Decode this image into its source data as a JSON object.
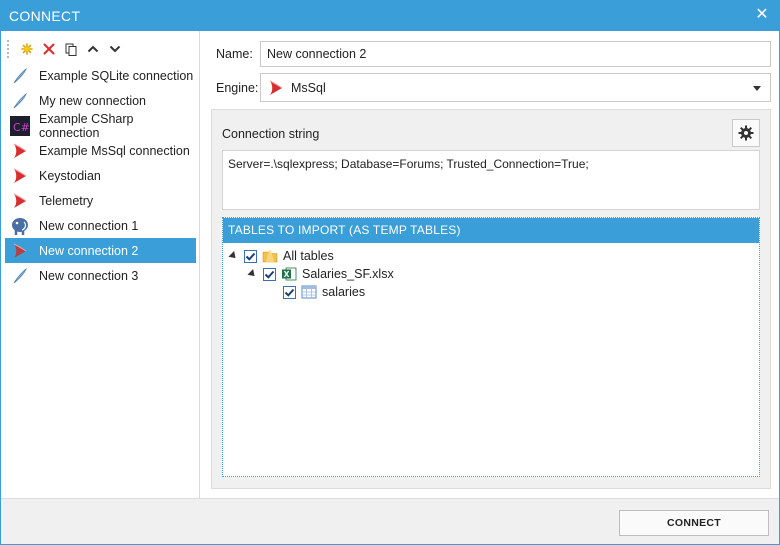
{
  "window": {
    "title": "CONNECT",
    "close_glyph": "✕"
  },
  "toolbar": {
    "buttons": [
      {
        "name": "new-connection-button",
        "icon": "sparkle-icon"
      },
      {
        "name": "delete-connection-button",
        "icon": "red-x-icon"
      },
      {
        "name": "copy-connection-button",
        "icon": "copy-icon"
      },
      {
        "name": "move-up-button",
        "icon": "chevron-up-icon"
      },
      {
        "name": "move-down-button",
        "icon": "chevron-down-icon"
      }
    ]
  },
  "connections": [
    {
      "label": "Example SQLite connection",
      "icon": "feather-icon",
      "selected": false
    },
    {
      "label": "My new connection",
      "icon": "feather-icon",
      "selected": false
    },
    {
      "label": "Example CSharp connection",
      "icon": "csharp-icon",
      "selected": false
    },
    {
      "label": "Example MsSql connection",
      "icon": "mssql-icon",
      "selected": false
    },
    {
      "label": "Keystodian",
      "icon": "mssql-icon",
      "selected": false
    },
    {
      "label": "Telemetry",
      "icon": "mssql-icon",
      "selected": false
    },
    {
      "label": "New connection 1",
      "icon": "postgres-elephant-icon",
      "selected": false
    },
    {
      "label": "New connection 2",
      "icon": "mssql-icon",
      "selected": true
    },
    {
      "label": "New connection 3",
      "icon": "feather-icon",
      "selected": false
    }
  ],
  "form": {
    "name_label": "Name:",
    "name_value": "New connection 2",
    "engine_label": "Engine:",
    "engine_value": "MsSql",
    "connection_string_label": "Connection string",
    "connection_string_value": "Server=.\\sqlexpress; Database=Forums; Trusted_Connection=True;"
  },
  "tables": {
    "header": "TABLES TO IMPORT (AS TEMP TABLES)",
    "tree": {
      "root": {
        "label": "All tables",
        "checked": true,
        "icon": "folder-icon"
      },
      "file": {
        "label": "Salaries_SF.xlsx",
        "checked": true,
        "icon": "excel-icon"
      },
      "table": {
        "label": "salaries",
        "checked": true,
        "icon": "table-icon"
      }
    }
  },
  "footer": {
    "connect_label": "CONNECT"
  },
  "colors": {
    "accent": "#3a9fd8",
    "mssql_red": "#d62e2e"
  }
}
